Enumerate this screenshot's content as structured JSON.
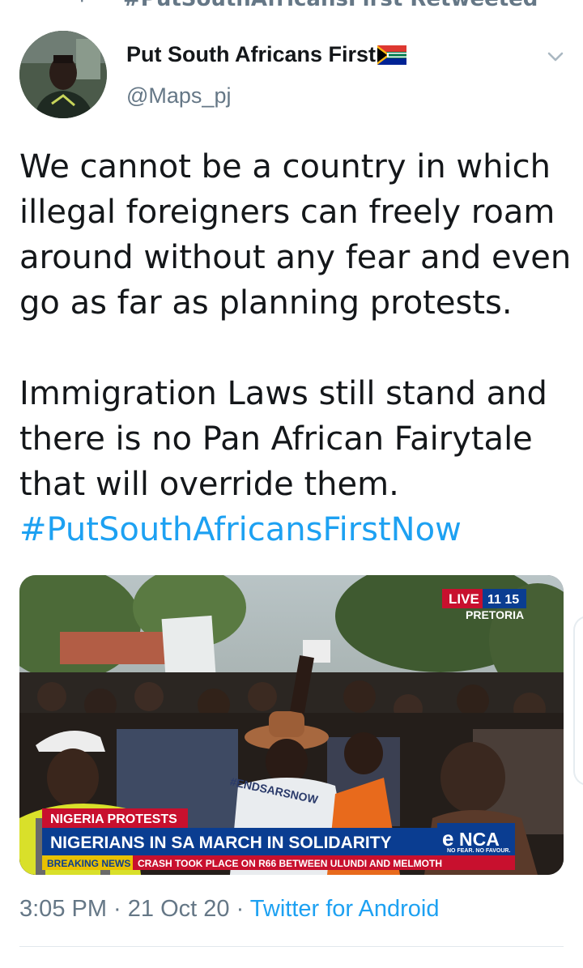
{
  "retweet": {
    "label": "#PutSouthAfricansFirst Retweeted"
  },
  "author": {
    "display_name": "Put South Africans First",
    "handle": "@Maps_pj"
  },
  "tweet": {
    "paragraph1": [
      "We cannot be a country in which",
      "illegal foreigners can freely roam",
      "around without any fear and even",
      "go as far as planning protests."
    ],
    "paragraph2": [
      "Immigration Laws still stand and",
      "there is no Pan African Fairytale",
      "that will override them."
    ],
    "hashtag": "#PutSouthAfricansFirstNow"
  },
  "media": {
    "live_label": "LIVE",
    "live_time": "11 15",
    "location": "PRETORIA",
    "topic_tag": "NIGERIA PROTESTS",
    "headline": "NIGERIANS IN SA MARCH IN SOLIDARITY",
    "channel_logo_e": "e",
    "channel_logo_nca": "NCA",
    "channel_tagline": "NO FEAR. NO FAVOUR.",
    "breaking_label": "BREAKING NEWS",
    "ticker": "CRASH TOOK PLACE ON R66 BETWEEN ULUNDI AND MELMOTH",
    "shirt_text": "#ENDSARSNOW"
  },
  "meta": {
    "time": "3:05 PM",
    "separator": " · ",
    "date": "21 Oct 20",
    "separator2": " · ",
    "source": "Twitter for Android"
  },
  "colors": {
    "link": "#1da1f2",
    "secondary_text": "#657786",
    "primary_text": "#14171a",
    "news_red": "#c8102e",
    "news_blue": "#0a3d91"
  }
}
